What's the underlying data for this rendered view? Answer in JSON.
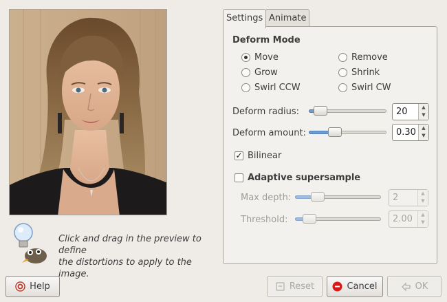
{
  "hint": {
    "line1": "Click and drag in the preview to define",
    "line2": "the distortions to apply to the image."
  },
  "tabs": {
    "settings": "Settings",
    "animate": "Animate"
  },
  "deform_mode": {
    "title": "Deform Mode",
    "options": [
      {
        "label": "Move",
        "selected": true
      },
      {
        "label": "Remove",
        "selected": false
      },
      {
        "label": "Grow",
        "selected": false
      },
      {
        "label": "Shrink",
        "selected": false
      },
      {
        "label": "Swirl CCW",
        "selected": false
      },
      {
        "label": "Swirl CW",
        "selected": false
      }
    ]
  },
  "deform_radius": {
    "label": "Deform radius:",
    "value": "20",
    "slider_fraction": 0.07
  },
  "deform_amount": {
    "label": "Deform amount:",
    "value": "0.30",
    "slider_fraction": 0.3
  },
  "bilinear": {
    "label": "Bilinear",
    "checked": true
  },
  "adaptive": {
    "label": "Adaptive supersample",
    "checked": false
  },
  "max_depth": {
    "label": "Max depth:",
    "value": "2",
    "slider_fraction": 0.22,
    "enabled": false
  },
  "threshold": {
    "label": "Threshold:",
    "value": "2.00",
    "slider_fraction": 0.1,
    "enabled": false
  },
  "buttons": {
    "help": "Help",
    "reset": "Reset",
    "cancel": "Cancel",
    "ok": "OK"
  },
  "colors": {
    "cancel_icon": "#d61a1a",
    "help_icon": "#c0392b",
    "slider_fill": "#6f9dd2"
  }
}
